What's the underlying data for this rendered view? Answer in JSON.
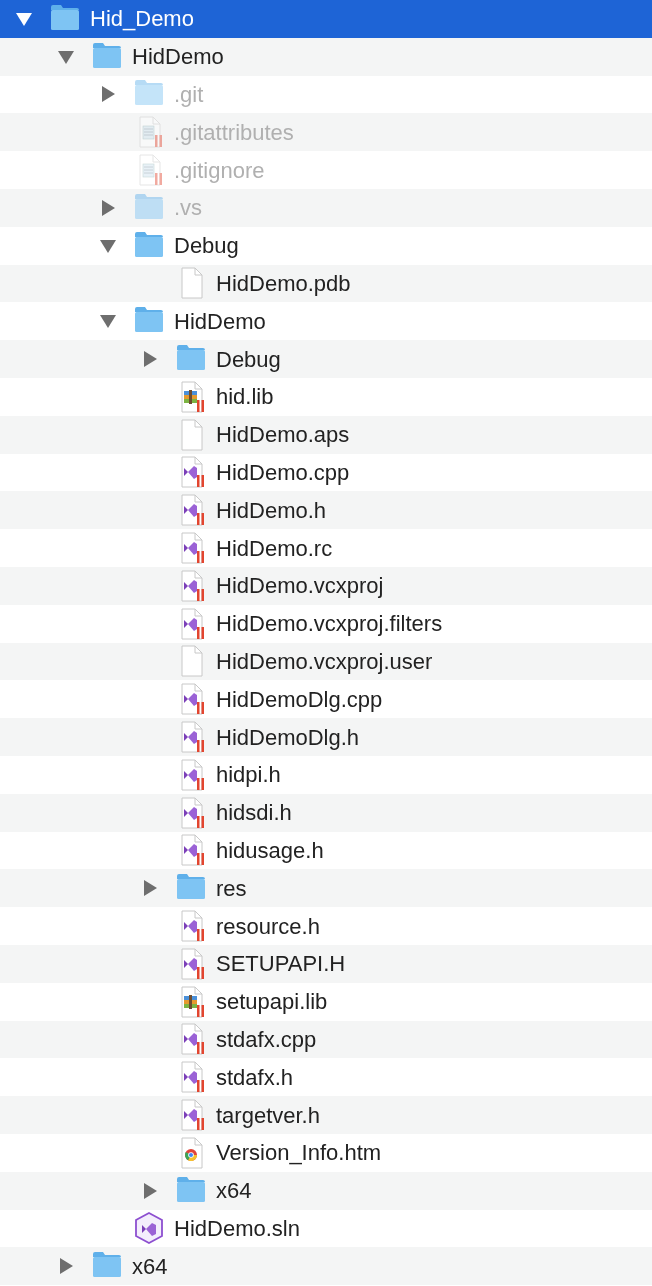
{
  "tree": [
    {
      "name": "Hid_Demo",
      "kind": "folder",
      "expanded": true,
      "selected": true,
      "dimmed": false,
      "badge": false,
      "children": [
        {
          "name": "HidDemo",
          "kind": "folder",
          "expanded": true,
          "selected": false,
          "dimmed": false,
          "badge": false,
          "children": [
            {
              "name": ".git",
              "kind": "folder",
              "expanded": false,
              "selected": false,
              "dimmed": true,
              "badge": false
            },
            {
              "name": ".gitattributes",
              "kind": "text",
              "selected": false,
              "dimmed": true,
              "badge": true
            },
            {
              "name": ".gitignore",
              "kind": "text",
              "selected": false,
              "dimmed": true,
              "badge": true
            },
            {
              "name": ".vs",
              "kind": "folder",
              "expanded": false,
              "selected": false,
              "dimmed": true,
              "badge": false
            },
            {
              "name": "Debug",
              "kind": "folder",
              "expanded": true,
              "selected": false,
              "dimmed": false,
              "badge": false,
              "children": [
                {
                  "name": "HidDemo.pdb",
                  "kind": "blank",
                  "selected": false,
                  "dimmed": false,
                  "badge": false
                }
              ]
            },
            {
              "name": "HidDemo",
              "kind": "folder",
              "expanded": true,
              "selected": false,
              "dimmed": false,
              "badge": false,
              "children": [
                {
                  "name": "Debug",
                  "kind": "folder",
                  "expanded": false,
                  "selected": false,
                  "dimmed": false,
                  "badge": false
                },
                {
                  "name": "hid.lib",
                  "kind": "archive",
                  "selected": false,
                  "dimmed": false,
                  "badge": true
                },
                {
                  "name": "HidDemo.aps",
                  "kind": "blank",
                  "selected": false,
                  "dimmed": false,
                  "badge": false
                },
                {
                  "name": "HidDemo.cpp",
                  "kind": "vs",
                  "selected": false,
                  "dimmed": false,
                  "badge": true
                },
                {
                  "name": "HidDemo.h",
                  "kind": "vs",
                  "selected": false,
                  "dimmed": false,
                  "badge": true
                },
                {
                  "name": "HidDemo.rc",
                  "kind": "vs",
                  "selected": false,
                  "dimmed": false,
                  "badge": true
                },
                {
                  "name": "HidDemo.vcxproj",
                  "kind": "vs",
                  "selected": false,
                  "dimmed": false,
                  "badge": true
                },
                {
                  "name": "HidDemo.vcxproj.filters",
                  "kind": "vs",
                  "selected": false,
                  "dimmed": false,
                  "badge": true
                },
                {
                  "name": "HidDemo.vcxproj.user",
                  "kind": "blank",
                  "selected": false,
                  "dimmed": false,
                  "badge": false
                },
                {
                  "name": "HidDemoDlg.cpp",
                  "kind": "vs",
                  "selected": false,
                  "dimmed": false,
                  "badge": true
                },
                {
                  "name": "HidDemoDlg.h",
                  "kind": "vs",
                  "selected": false,
                  "dimmed": false,
                  "badge": true
                },
                {
                  "name": "hidpi.h",
                  "kind": "vs",
                  "selected": false,
                  "dimmed": false,
                  "badge": true
                },
                {
                  "name": "hidsdi.h",
                  "kind": "vs",
                  "selected": false,
                  "dimmed": false,
                  "badge": true
                },
                {
                  "name": "hidusage.h",
                  "kind": "vs",
                  "selected": false,
                  "dimmed": false,
                  "badge": true
                },
                {
                  "name": "res",
                  "kind": "folder",
                  "expanded": false,
                  "selected": false,
                  "dimmed": false,
                  "badge": false
                },
                {
                  "name": "resource.h",
                  "kind": "vs",
                  "selected": false,
                  "dimmed": false,
                  "badge": true
                },
                {
                  "name": "SETUPAPI.H",
                  "kind": "vs",
                  "selected": false,
                  "dimmed": false,
                  "badge": true
                },
                {
                  "name": "setupapi.lib",
                  "kind": "archive",
                  "selected": false,
                  "dimmed": false,
                  "badge": true
                },
                {
                  "name": "stdafx.cpp",
                  "kind": "vs",
                  "selected": false,
                  "dimmed": false,
                  "badge": true
                },
                {
                  "name": "stdafx.h",
                  "kind": "vs",
                  "selected": false,
                  "dimmed": false,
                  "badge": true
                },
                {
                  "name": "targetver.h",
                  "kind": "vs",
                  "selected": false,
                  "dimmed": false,
                  "badge": true
                },
                {
                  "name": "Version_Info.htm",
                  "kind": "web",
                  "selected": false,
                  "dimmed": false,
                  "badge": false
                },
                {
                  "name": "x64",
                  "kind": "folder",
                  "expanded": false,
                  "selected": false,
                  "dimmed": false,
                  "badge": false
                }
              ]
            },
            {
              "name": "HidDemo.sln",
              "kind": "solution",
              "selected": false,
              "dimmed": false,
              "badge": false
            }
          ]
        },
        {
          "name": "x64",
          "kind": "folder",
          "expanded": false,
          "selected": false,
          "dimmed": false,
          "badge": false
        }
      ]
    }
  ]
}
